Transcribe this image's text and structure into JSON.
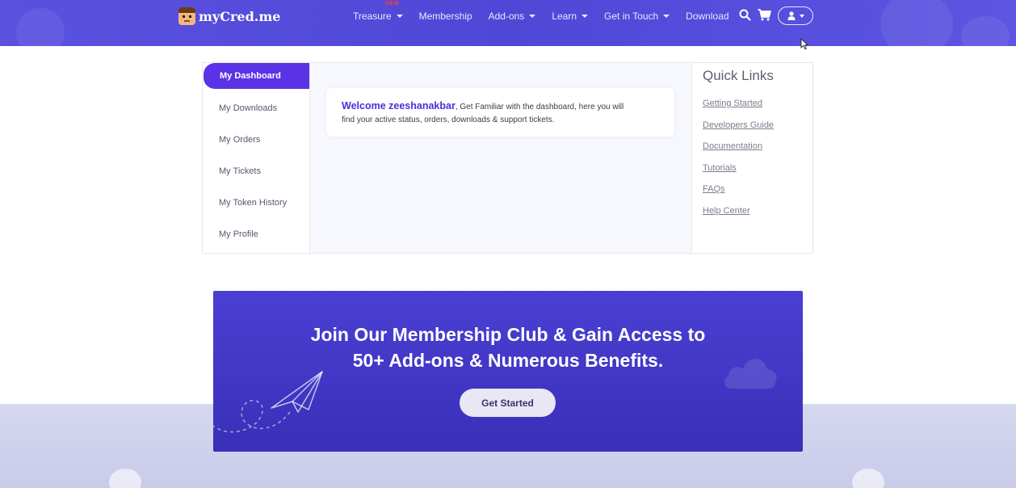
{
  "brand": {
    "name": "myCred.me"
  },
  "nav": {
    "items": [
      {
        "label": "Treasure",
        "dropdown": true,
        "badge": "NEW"
      },
      {
        "label": "Membership",
        "dropdown": false
      },
      {
        "label": "Add-ons",
        "dropdown": true
      },
      {
        "label": "Learn",
        "dropdown": true
      },
      {
        "label": "Get in Touch",
        "dropdown": true
      },
      {
        "label": "Download",
        "dropdown": false
      }
    ],
    "icons": [
      "search-icon",
      "cart-icon",
      "user-icon"
    ]
  },
  "sidebar": {
    "items": [
      {
        "label": "My Dashboard",
        "active": true
      },
      {
        "label": "My Downloads"
      },
      {
        "label": "My Orders"
      },
      {
        "label": "My Tickets"
      },
      {
        "label": "My Token History"
      },
      {
        "label": "My Profile"
      }
    ]
  },
  "welcome": {
    "greeting": "Welcome zeeshanakbar",
    "message_line1": ", Get Familiar with the dashboard, here you will",
    "message_line2": "find your active status, orders, downloads & support tickets."
  },
  "quick_links": {
    "title": "Quick Links",
    "items": [
      "Getting Started",
      "Developers Guide",
      "Documentation",
      "Tutorials",
      "FAQs",
      "Help Center"
    ]
  },
  "banner": {
    "title_line1": "Join Our Membership Club & Gain Access to",
    "title_line2": "50+ Add-ons & Numerous Benefits.",
    "cta_label": "Get Started"
  },
  "colors": {
    "nav_bg": "#5a51df",
    "active_sidebar": "#5b33e6",
    "banner_bg": "#4b3fd4",
    "new_badge": "#ff3b3b"
  }
}
